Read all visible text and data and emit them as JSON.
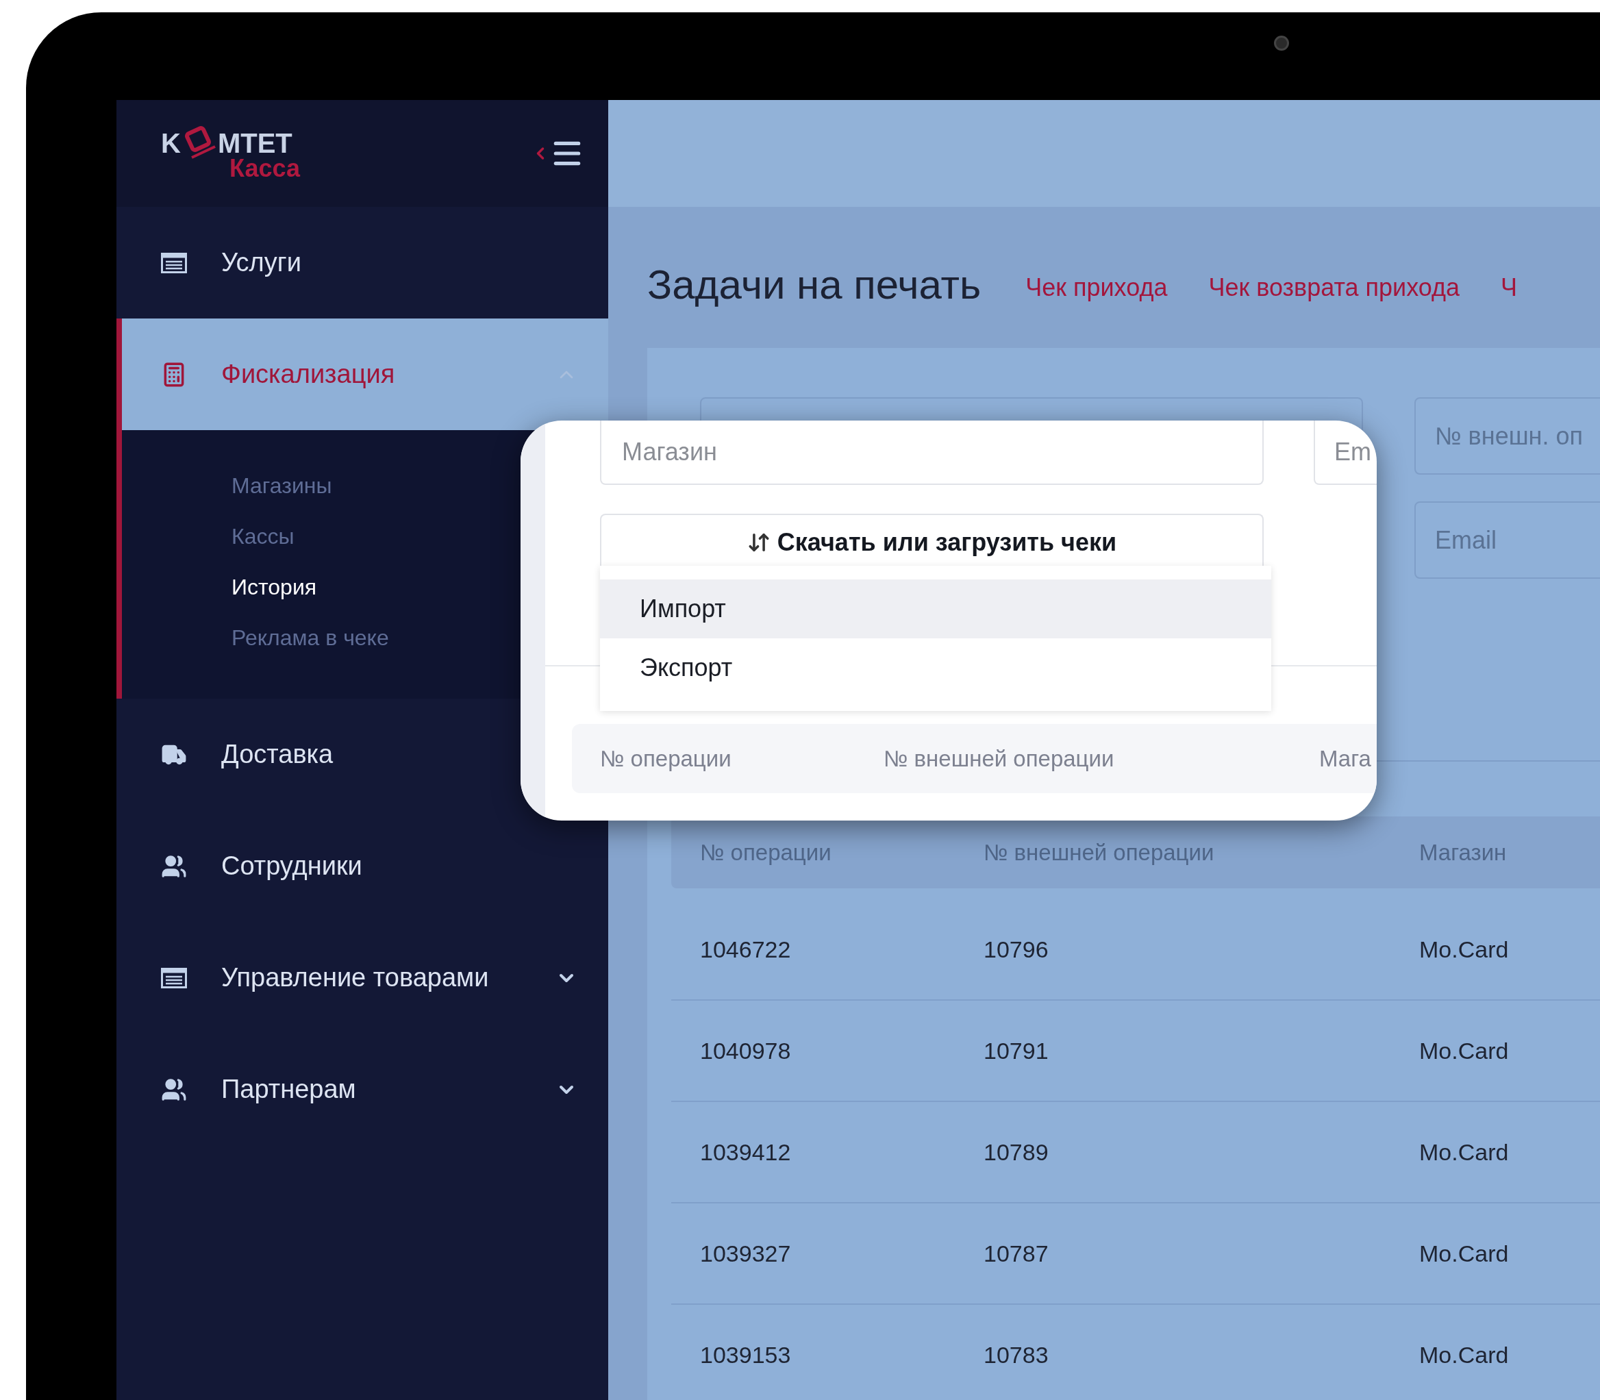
{
  "logo": {
    "left": "K",
    "right": "МТЕТ",
    "bottom": "Касса"
  },
  "sidebar": {
    "items": [
      {
        "label": "Услуги",
        "selected": false
      },
      {
        "label": "Фискализация",
        "selected": true,
        "expanded": true,
        "children": [
          {
            "label": "Магазины",
            "selected": false
          },
          {
            "label": "Кассы",
            "selected": false
          },
          {
            "label": "История",
            "selected": true
          },
          {
            "label": "Реклама в чеке",
            "selected": false
          }
        ]
      },
      {
        "label": "Доставка",
        "selected": false
      },
      {
        "label": "Сотрудники",
        "selected": false
      },
      {
        "label": "Управление товарами",
        "selected": false,
        "expanded": false
      },
      {
        "label": "Партнерам",
        "selected": false,
        "expanded": false
      }
    ]
  },
  "page": {
    "title": "Задачи на печать",
    "links": [
      "Чек прихода",
      "Чек возврата прихода",
      "Ч"
    ]
  },
  "filters": {
    "placeholders": [
      "№ внешн. оп",
      "Email"
    ]
  },
  "table": {
    "columns": [
      "№ операции",
      "№ внешней операции",
      "Магазин"
    ],
    "rows": [
      [
        "1046722",
        "10796",
        "Mo.Card"
      ],
      [
        "1040978",
        "10791",
        "Mo.Card"
      ],
      [
        "1039412",
        "10789",
        "Mo.Card"
      ],
      [
        "1039327",
        "10787",
        "Mo.Card"
      ],
      [
        "1039153",
        "10783",
        "Mo.Card"
      ]
    ]
  },
  "callout": {
    "field_placeholder": "Магазин",
    "field2_placeholder": "Em",
    "button": "Скачать или загрузить чеки",
    "menu": [
      {
        "label": "Импорт",
        "selected": true
      },
      {
        "label": "Экспорт",
        "selected": false
      }
    ],
    "columns": [
      "№ операции",
      "№ внешней операции",
      "Мага"
    ]
  }
}
